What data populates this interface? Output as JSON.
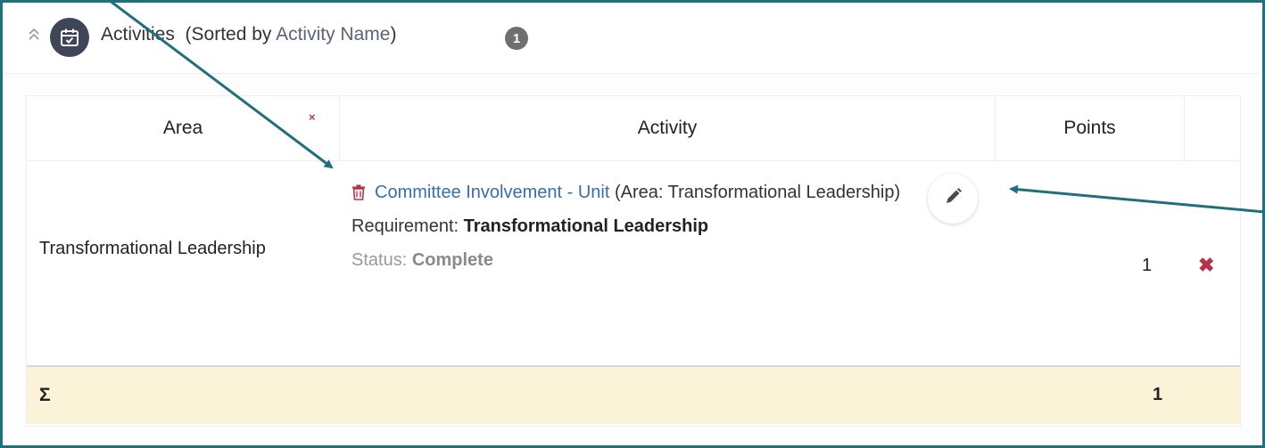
{
  "header": {
    "title": "Activities",
    "sorted_prefix": "(Sorted by ",
    "sort_field": "Activity Name",
    "sorted_suffix": ")",
    "count": "1",
    "collapse_icon": "double-chevron-up-icon",
    "section_icon": "calendar-check-icon"
  },
  "table": {
    "columns": [
      "Area",
      "Activity",
      "Points"
    ],
    "clear_filter_label": "×",
    "rows": [
      {
        "area": "Transformational Leadership",
        "activity_name": "Committee Involvement - Unit",
        "activity_area_note": " (Area: Transformational Leadership)",
        "requirement_label": "Requirement: ",
        "requirement_value": "Transformational Leadership",
        "status_label": "Status: ",
        "status_value": "Complete",
        "points": "1",
        "delete_label": "✖",
        "edit_icon": "pencil-icon",
        "trash_icon": "trash-icon"
      }
    ],
    "total": {
      "symbol": "Σ",
      "points": "1"
    }
  },
  "colors": {
    "frame": "#1f6f7c",
    "arrow": "#1f6f7c",
    "link": "#3a6ea5",
    "delete": "#b5324c",
    "total_row_bg": "#faf3d8",
    "badge": "#6f6f6f"
  }
}
